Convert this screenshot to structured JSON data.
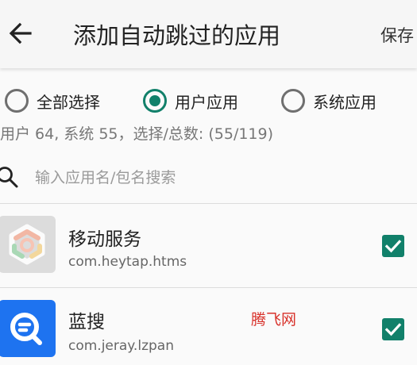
{
  "header": {
    "back_icon": "arrow-back-icon",
    "title": "添加自动跳过的应用",
    "save_label": "保存"
  },
  "filter": {
    "options": [
      {
        "label": "全部选择",
        "selected": false
      },
      {
        "label": "用户应用",
        "selected": true
      },
      {
        "label": "系统应用",
        "selected": false
      }
    ],
    "summary": "用户 64, 系统 55，选择/总数: (55/119)"
  },
  "search": {
    "icon": "search-icon",
    "placeholder": "输入应用名/包名搜索",
    "value": ""
  },
  "apps": [
    {
      "name": "移动服务",
      "package": "com.heytap.htms",
      "checked": true,
      "icon": "heytap-services-icon"
    },
    {
      "name": "蓝搜",
      "package": "com.jeray.lzpan",
      "checked": true,
      "icon": "lansou-search-icon"
    }
  ],
  "watermark": "腾飞网",
  "colors": {
    "accent": "#11806a",
    "lansou_icon_bg": "#1e73f0",
    "watermark": "#d8322b"
  }
}
